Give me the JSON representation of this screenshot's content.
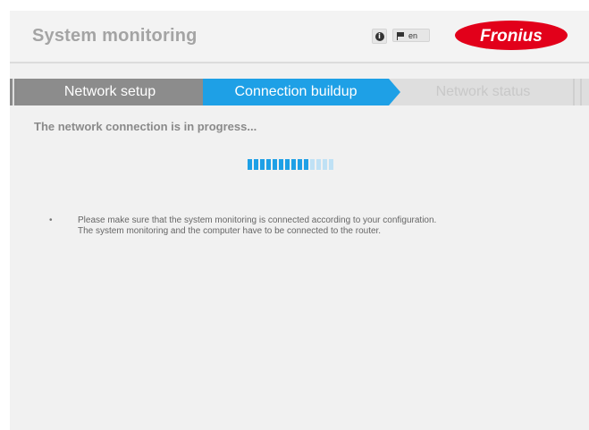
{
  "header": {
    "title": "System monitoring",
    "info_icon": "i",
    "language": "en",
    "logo_text": "Fronius",
    "brand_color": "#e2001a"
  },
  "wizard": {
    "steps": [
      {
        "label": "Network setup",
        "state": "done"
      },
      {
        "label": "Connection buildup",
        "state": "active"
      },
      {
        "label": "Network status",
        "state": "pending"
      }
    ],
    "active_color": "#1ea0e6"
  },
  "main": {
    "status": "The network connection is in progress...",
    "progress": {
      "segments_total": 14,
      "segments_filled": 10
    },
    "notice_line1": "Please make sure that the system monitoring is connected according to your configuration.",
    "notice_line2": "The system monitoring and the computer have to be connected to the router."
  }
}
